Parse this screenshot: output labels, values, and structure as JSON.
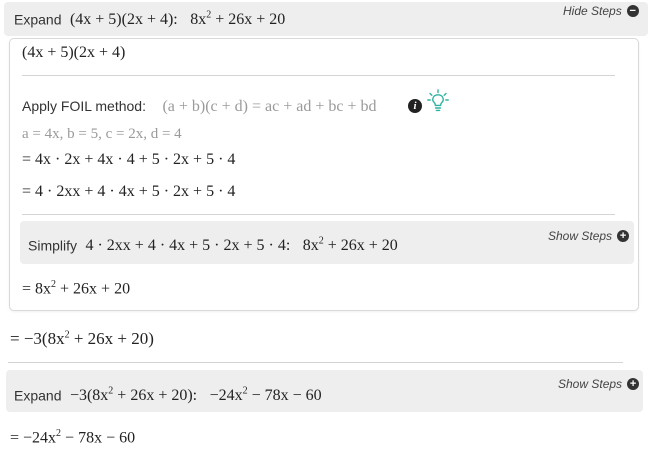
{
  "header": {
    "expand_label": "Expand",
    "expression": "(4x + 5)(2x + 4):",
    "result_pre": "8x",
    "result_exp": "2",
    "result_post": " + 26x + 20",
    "hide_steps": "Hide Steps"
  },
  "card": {
    "first_line": "(4x + 5)(2x + 4)",
    "foil_label": "Apply FOIL method:",
    "foil_formula": "(a + b)(c + d) = ac + ad + bc + bd",
    "assignment": "a = 4x, b = 5, c = 2x, d = 4",
    "line1": "= 4x · 2x + 4x · 4 + 5 · 2x + 5 · 4",
    "line2": "= 4 · 2xx + 4 · 4x + 5 · 2x + 5 · 4",
    "simplify_label": "Simplify",
    "simplify_expr": "4 · 2xx + 4 · 4x + 5 · 2x + 5 · 4:",
    "simplify_result_pre": "8x",
    "simplify_result_exp": "2",
    "simplify_result_post": " + 26x + 20",
    "show_steps": "Show Steps",
    "result_pre": "= 8x",
    "result_exp": "2",
    "result_post": " + 26x + 20"
  },
  "outer": {
    "line_pre": "= −3(8x",
    "line_exp": "2",
    "line_post": " + 26x + 20)",
    "expand_label": "Expand",
    "expand_expr_pre": "−3(8x",
    "expand_expr_exp": "2",
    "expand_expr_post": " + 26x + 20):",
    "expand_result_pre": "−24x",
    "expand_result_exp": "2",
    "expand_result_post": " − 78x − 60",
    "show_steps": "Show Steps",
    "final_pre": "= −24x",
    "final_exp": "2",
    "final_post": " − 78x − 60"
  },
  "icons": {
    "hide": "minus-circle-icon",
    "show": "plus-circle-icon",
    "info": "info-icon",
    "hint": "lightbulb-icon"
  },
  "colors": {
    "band": "#eeeeee",
    "hint": "#2fb3a0",
    "gray_text": "#9a9a9a"
  }
}
